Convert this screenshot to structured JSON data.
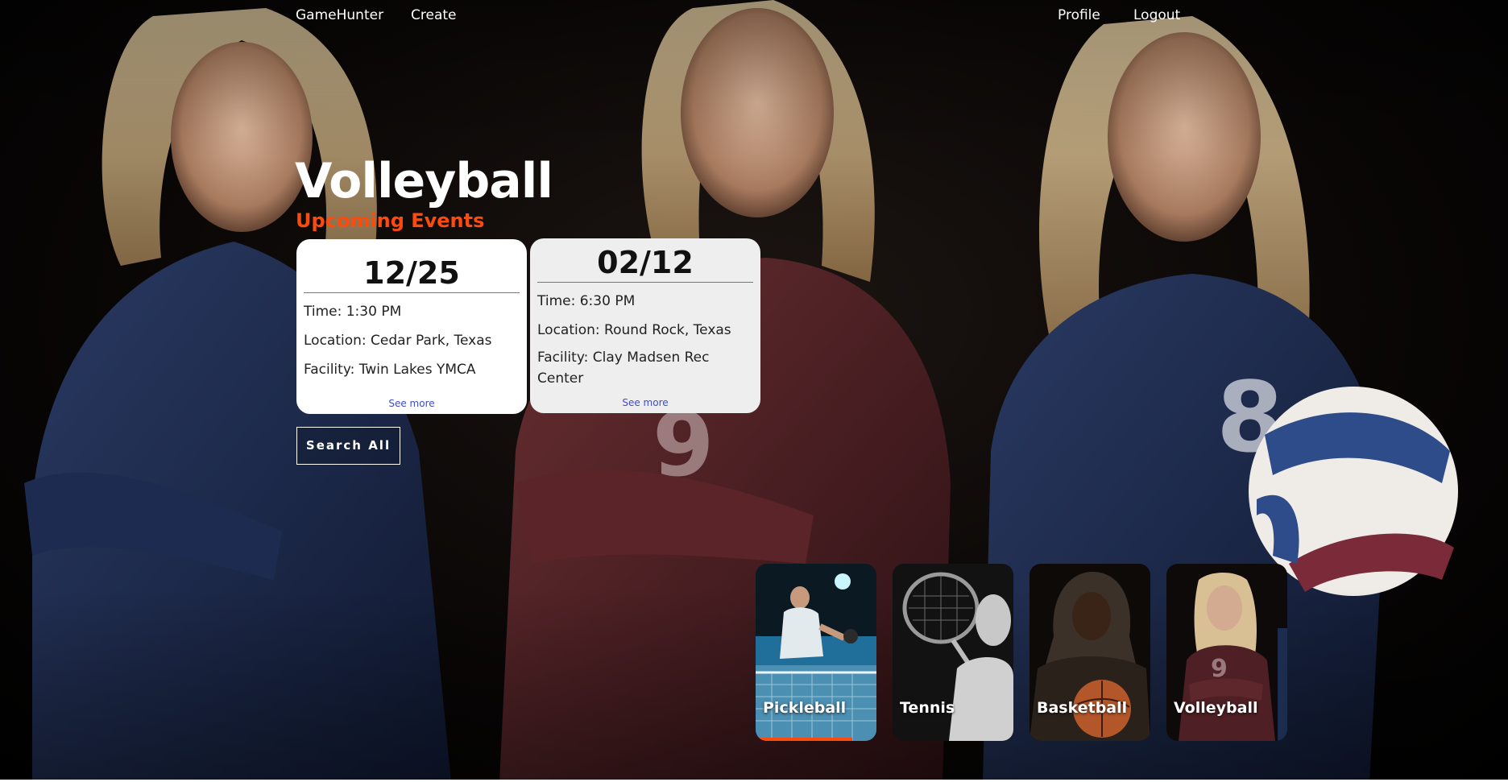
{
  "nav": {
    "brand": "GameHunter",
    "create": "Create",
    "profile": "Profile",
    "logout": "Logout"
  },
  "hero": {
    "title": "Volleyball",
    "subtitle": "Upcoming Events"
  },
  "events": [
    {
      "date": "12/25",
      "time": "Time: 1:30 PM",
      "location": "Location: Cedar Park, Texas",
      "facility": "Facility: Twin Lakes YMCA",
      "see_more": "See more"
    },
    {
      "date": "02/12",
      "time": "Time: 6:30 PM",
      "location": "Location: Round Rock, Texas",
      "facility": "Facility: Clay Madsen Rec Center",
      "see_more": "See more"
    }
  ],
  "search_all_label": "Search All",
  "sports": [
    {
      "label": "Pickleball",
      "active": true
    },
    {
      "label": "Tennis",
      "active": false
    },
    {
      "label": "Basketball",
      "active": false
    },
    {
      "label": "Volleyball",
      "active": false
    }
  ],
  "colors": {
    "accent": "#ff4a0d",
    "link": "#3d4ad8",
    "jersey_navy": "#1c2c4f",
    "jersey_maroon": "#4e1f24"
  }
}
